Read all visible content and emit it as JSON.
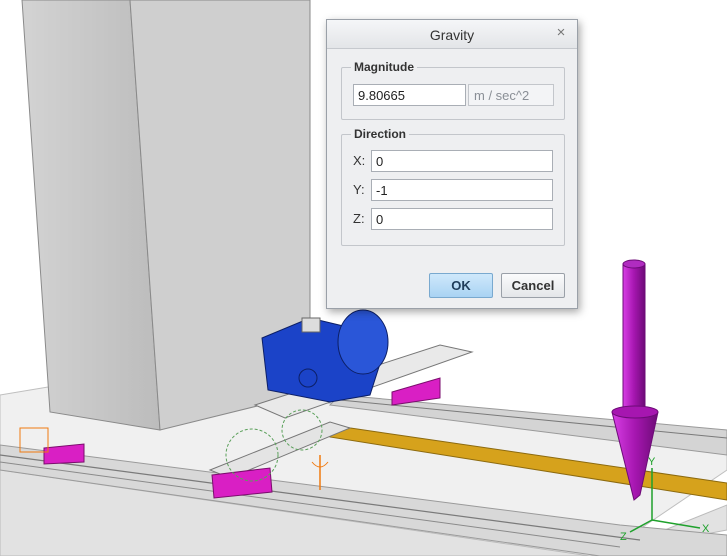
{
  "dialog": {
    "title": "Gravity",
    "close_symbol": "×",
    "magnitude": {
      "legend": "Magnitude",
      "value": "9.80665",
      "unit": "m / sec^2"
    },
    "direction": {
      "legend": "Direction",
      "x_label": "X:",
      "x_value": "0",
      "y_label": "Y:",
      "y_value": "-1",
      "z_label": "Z:",
      "z_value": "0"
    },
    "ok_label": "OK",
    "cancel_label": "Cancel"
  },
  "triad": {
    "x_label": "X",
    "y_label": "Y",
    "z_label": "Z"
  },
  "colors": {
    "gravity_arrow": "#a616b0",
    "motor_blue": "#1b43c8",
    "carriage_magenta": "#d91fc4",
    "rail_gold": "#d6a21c"
  }
}
